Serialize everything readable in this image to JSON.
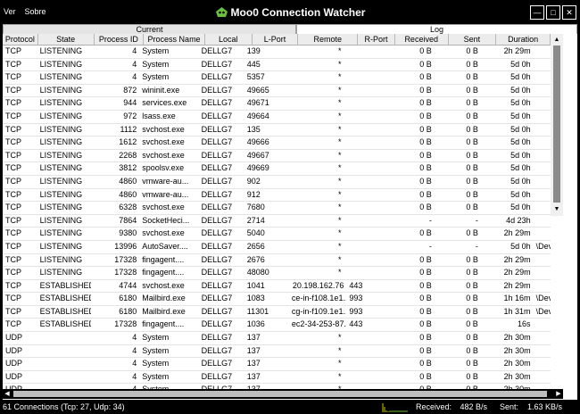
{
  "menu": [
    "Ver",
    "Sobre"
  ],
  "window": {
    "title": "Moo0 Connection Watcher"
  },
  "tabs": {
    "current": "Current",
    "log": "Log"
  },
  "columns": [
    "Protocol",
    "State",
    "Process ID",
    "Process Name",
    "Local",
    "L-Port",
    "Remote",
    "R-Port",
    "Received",
    "Sent",
    "Duration",
    ""
  ],
  "rows": [
    [
      "TCP",
      "LISTENING",
      "4",
      "System",
      "DELLG7",
      "139",
      "*",
      "",
      "0 B",
      "0 B",
      "2h 29m",
      ""
    ],
    [
      "TCP",
      "LISTENING",
      "4",
      "System",
      "DELLG7",
      "445",
      "*",
      "",
      "0 B",
      "0 B",
      "5d 0h",
      ""
    ],
    [
      "TCP",
      "LISTENING",
      "4",
      "System",
      "DELLG7",
      "5357",
      "*",
      "",
      "0 B",
      "0 B",
      "5d 0h",
      ""
    ],
    [
      "TCP",
      "LISTENING",
      "872",
      "wininit.exe",
      "DELLG7",
      "49665",
      "*",
      "",
      "0 B",
      "0 B",
      "5d 0h",
      ""
    ],
    [
      "TCP",
      "LISTENING",
      "944",
      "services.exe",
      "DELLG7",
      "49671",
      "*",
      "",
      "0 B",
      "0 B",
      "5d 0h",
      ""
    ],
    [
      "TCP",
      "LISTENING",
      "972",
      "lsass.exe",
      "DELLG7",
      "49664",
      "*",
      "",
      "0 B",
      "0 B",
      "5d 0h",
      ""
    ],
    [
      "TCP",
      "LISTENING",
      "1112",
      "svchost.exe",
      "DELLG7",
      "135",
      "*",
      "",
      "0 B",
      "0 B",
      "5d 0h",
      ""
    ],
    [
      "TCP",
      "LISTENING",
      "1612",
      "svchost.exe",
      "DELLG7",
      "49666",
      "*",
      "",
      "0 B",
      "0 B",
      "5d 0h",
      ""
    ],
    [
      "TCP",
      "LISTENING",
      "2268",
      "svchost.exe",
      "DELLG7",
      "49667",
      "*",
      "",
      "0 B",
      "0 B",
      "5d 0h",
      ""
    ],
    [
      "TCP",
      "LISTENING",
      "3812",
      "spoolsv.exe",
      "DELLG7",
      "49669",
      "*",
      "",
      "0 B",
      "0 B",
      "5d 0h",
      ""
    ],
    [
      "TCP",
      "LISTENING",
      "4860",
      "vmware-au...",
      "DELLG7",
      "902",
      "*",
      "",
      "0 B",
      "0 B",
      "5d 0h",
      ""
    ],
    [
      "TCP",
      "LISTENING",
      "4860",
      "vmware-au...",
      "DELLG7",
      "912",
      "*",
      "",
      "0 B",
      "0 B",
      "5d 0h",
      ""
    ],
    [
      "TCP",
      "LISTENING",
      "6328",
      "svchost.exe",
      "DELLG7",
      "7680",
      "*",
      "",
      "0 B",
      "0 B",
      "5d 0h",
      ""
    ],
    [
      "TCP",
      "LISTENING",
      "7864",
      "SocketHeci...",
      "DELLG7",
      "2714",
      "*",
      "",
      "-",
      "-",
      "4d 23h",
      ""
    ],
    [
      "TCP",
      "LISTENING",
      "9380",
      "svchost.exe",
      "DELLG7",
      "5040",
      "*",
      "",
      "0 B",
      "0 B",
      "2h 29m",
      ""
    ],
    [
      "TCP",
      "LISTENING",
      "13996",
      "AutoSaver....",
      "DELLG7",
      "2656",
      "*",
      "",
      "-",
      "-",
      "5d 0h",
      "\\Dev"
    ],
    [
      "TCP",
      "LISTENING",
      "17328",
      "fingagent....",
      "DELLG7",
      "2676",
      "*",
      "",
      "0 B",
      "0 B",
      "2h 29m",
      ""
    ],
    [
      "TCP",
      "LISTENING",
      "17328",
      "fingagent....",
      "DELLG7",
      "48080",
      "*",
      "",
      "0 B",
      "0 B",
      "2h 29m",
      ""
    ],
    [
      "TCP",
      "ESTABLISHED",
      "4744",
      "svchost.exe",
      "DELLG7",
      "1041",
      "20.198.162.76",
      "443",
      "0 B",
      "0 B",
      "2h 29m",
      ""
    ],
    [
      "TCP",
      "ESTABLISHED",
      "6180",
      "Mailbird.exe",
      "DELLG7",
      "1083",
      "ce-in-f108.1e1...",
      "993",
      "0 B",
      "0 B",
      "1h 16m",
      "\\Dev"
    ],
    [
      "TCP",
      "ESTABLISHED",
      "6180",
      "Mailbird.exe",
      "DELLG7",
      "11301",
      "cg-in-f109.1e1...",
      "993",
      "0 B",
      "0 B",
      "1h 31m",
      "\\Dev"
    ],
    [
      "TCP",
      "ESTABLISHED",
      "17328",
      "fingagent....",
      "DELLG7",
      "1036",
      "ec2-34-253-87....",
      "443",
      "0 B",
      "0 B",
      "16s",
      ""
    ],
    [
      "UDP",
      "",
      "4",
      "System",
      "DELLG7",
      "137",
      "*",
      "",
      "0 B",
      "0 B",
      "2h 30m",
      ""
    ],
    [
      "UDP",
      "",
      "4",
      "System",
      "DELLG7",
      "137",
      "*",
      "",
      "0 B",
      "0 B",
      "2h 30m",
      ""
    ],
    [
      "UDP",
      "",
      "4",
      "System",
      "DELLG7",
      "137",
      "*",
      "",
      "0 B",
      "0 B",
      "2h 30m",
      ""
    ],
    [
      "UDP",
      "",
      "4",
      "System",
      "DELLG7",
      "137",
      "*",
      "",
      "0 B",
      "0 B",
      "2h 30m",
      ""
    ],
    [
      "UDP",
      "",
      "4",
      "System",
      "DELLG7",
      "137",
      "*",
      "",
      "0 B",
      "0 B",
      "2h 30m",
      ""
    ]
  ],
  "status": {
    "connections": "61 Connections (Tcp: 27, Udp: 34)",
    "received_label": "Received:",
    "received_value": "482 B/s",
    "sent_label": "Sent:",
    "sent_value": "1.63 KB/s"
  },
  "colors": {
    "accent_green": "#6abf3f",
    "graph_yellow": "#c8c800"
  },
  "icons": [
    "moo0-logo-icon",
    "minimize-icon",
    "maximize-icon",
    "close-icon",
    "scroll-up-icon",
    "scroll-down-icon",
    "scroll-left-icon",
    "scroll-right-icon"
  ]
}
